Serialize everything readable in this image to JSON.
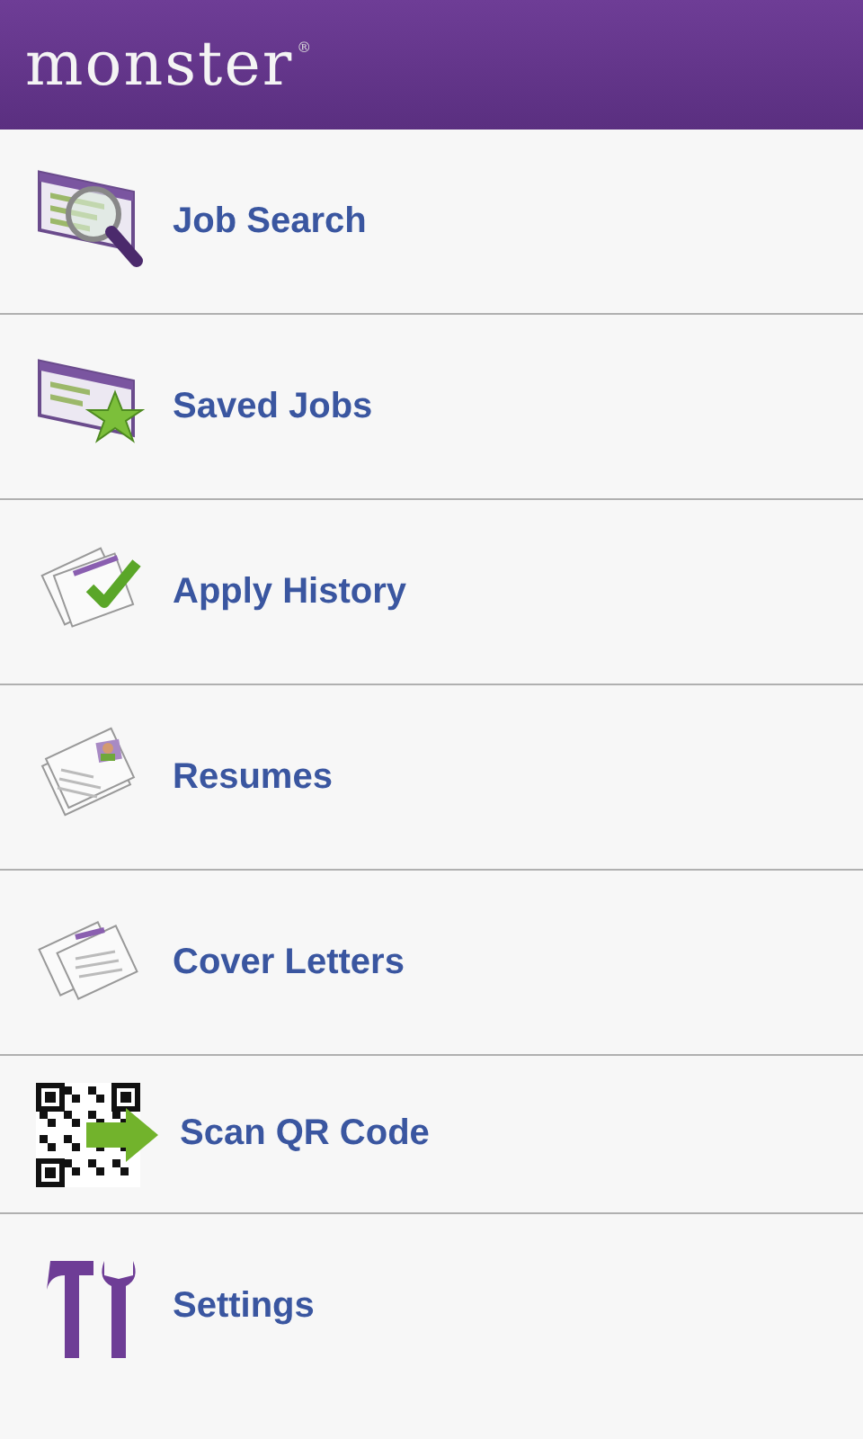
{
  "header": {
    "logo": "monster",
    "logo_mark": "®"
  },
  "menu": [
    {
      "label": "Job Search",
      "kind": "search"
    },
    {
      "label": "Saved Jobs",
      "kind": "saved"
    },
    {
      "label": "Apply History",
      "kind": "history"
    },
    {
      "label": "Resumes",
      "kind": "resume"
    },
    {
      "label": "Cover Letters",
      "kind": "letters"
    },
    {
      "label": "Scan QR Code",
      "kind": "qr"
    },
    {
      "label": "Settings",
      "kind": "settings"
    }
  ]
}
